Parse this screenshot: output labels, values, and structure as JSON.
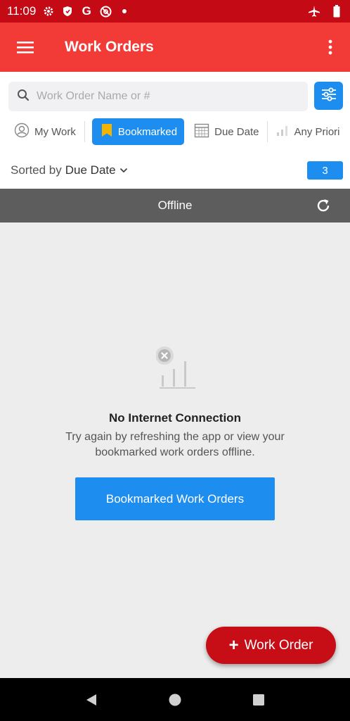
{
  "status_bar": {
    "time": "11:09",
    "left_icons": [
      "settings-icon",
      "shield-icon",
      "google-icon",
      "at-sign-icon",
      "dot-icon"
    ],
    "right_icons": [
      "airplane-icon",
      "battery-icon"
    ]
  },
  "app_bar": {
    "title": "Work Orders",
    "menu_icon": "hamburger-icon",
    "overflow_icon": "more-vertical-icon"
  },
  "search": {
    "placeholder": "Work Order Name or #",
    "value": "",
    "filter_icon": "sliders-icon"
  },
  "chips": [
    {
      "label": "My Work",
      "icon": "user-icon",
      "active": false
    },
    {
      "label": "Bookmarked",
      "icon": "bookmark-icon",
      "active": true
    },
    {
      "label": "Due Date",
      "icon": "calendar-icon",
      "active": false
    },
    {
      "label": "Any Priori",
      "icon": "priority-bars-icon",
      "active": false
    }
  ],
  "sort": {
    "prefix": "Sorted by",
    "value": "Due Date",
    "count": "3"
  },
  "offline": {
    "label": "Offline",
    "refresh_icon": "refresh-icon"
  },
  "empty_state": {
    "title": "No Internet Connection",
    "description": "Try again by refreshing the app or view your bookmarked work orders offline.",
    "button_label": "Bookmarked Work Orders",
    "illustration_icon": "no-signal-icon"
  },
  "fab": {
    "plus": "+",
    "label": "Work Order"
  },
  "colors": {
    "status_bar": "#c40a14",
    "app_bar": "#f23a36",
    "accent_blue": "#1d8df0",
    "fab": "#c70e17",
    "offline_bar": "#5d5d5e"
  }
}
